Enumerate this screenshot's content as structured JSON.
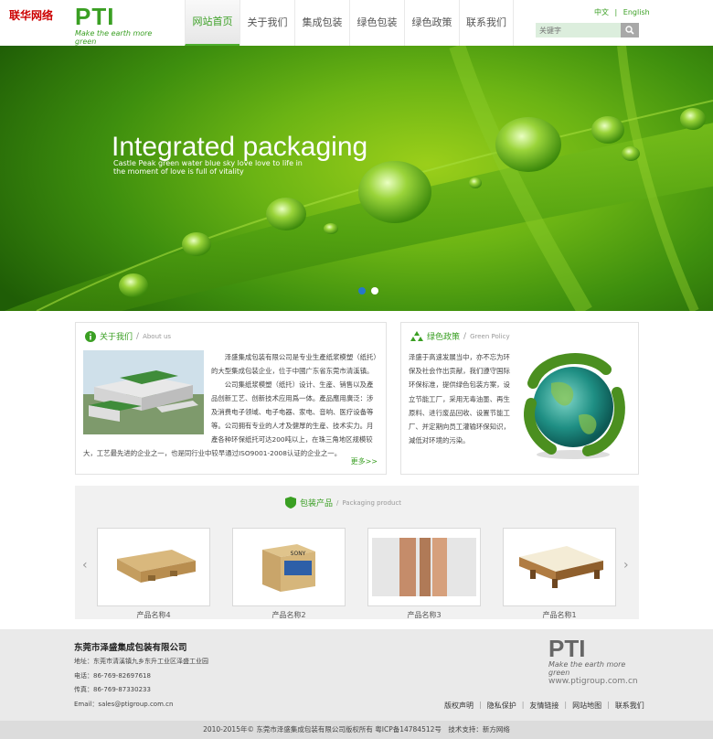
{
  "corner_mark": "联华网络",
  "logo": {
    "text": "PTI",
    "slogan": "Make the earth more green",
    "url": "www.ptigroup.com.cn"
  },
  "nav": [
    "网站首页",
    "关于我们",
    "集成包装",
    "绿色包装",
    "绿色政策",
    "联系我们"
  ],
  "lang": {
    "zh": "中文",
    "sep": "|",
    "en": "English"
  },
  "search": {
    "placeholder": "关键字"
  },
  "banner": {
    "title": "Integrated packaging",
    "subtitle": "Castle Peak green water blue sky love love to life in the moment of love is full of vitality"
  },
  "about": {
    "title": "关于我们",
    "subtitle": "About us",
    "p1": "　　泽盛集成包装有限公司是专业生產纸浆模塑（纸托）的大型集成包装企业，位于中國广东省东莞市清溪镇。",
    "p2": "　　公司集纸浆模塑（纸托）设计、生産、销售以及產品创新工艺、创新技术应用爲一体。產品應用廣泛：涉及消费电子领域、电子电器、家电、音响、医疗设备等等。公司拥有专业的人才及健厚的生産、技术实力。月產各种环保纸托可达200吨以上，在珠三角地区规模较大，工艺最先进的企业之一，也是同行业中较早通过ISO9001-2008认证的企业之一。",
    "more": "更多>>"
  },
  "green_policy": {
    "title": "绿色政策",
    "subtitle": "Green Policy",
    "text": "泽盛于高速发展当中，亦不忘为环保及社会作出贡献，我们遵守国际环保标准，提供绿色包装方案，设立节能工厂，采用无毒油墨、再生原料、进行废品回收、设置节能工厂、并定期向员工灌输环保知识，減低对环境的污染。"
  },
  "products": {
    "title": "包装产品",
    "subtitle": "Packaging product",
    "items": [
      {
        "name": "产品名称4"
      },
      {
        "name": "产品名称2"
      },
      {
        "name": "产品名称3"
      },
      {
        "name": "产品名称1"
      }
    ],
    "box_brand": "SONY"
  },
  "footer": {
    "company": "东莞市泽盛集成包装有限公司",
    "address": "地址：东莞市清溪镇九乡东升工业区泽盛工业园",
    "phone": "电话：86-769-82697618",
    "fax": "传真：86-769-87330233",
    "email": "Email：sales@ptigroup.com.cn",
    "links": [
      "版权声明",
      "隐私保护",
      "友情链接",
      "网站地图",
      "联系我们"
    ],
    "copyright": "2010-2015年© 东莞市泽盛集成包装有限公司版权所有 粤ICP备14784512号　技术支持：新方网络"
  }
}
